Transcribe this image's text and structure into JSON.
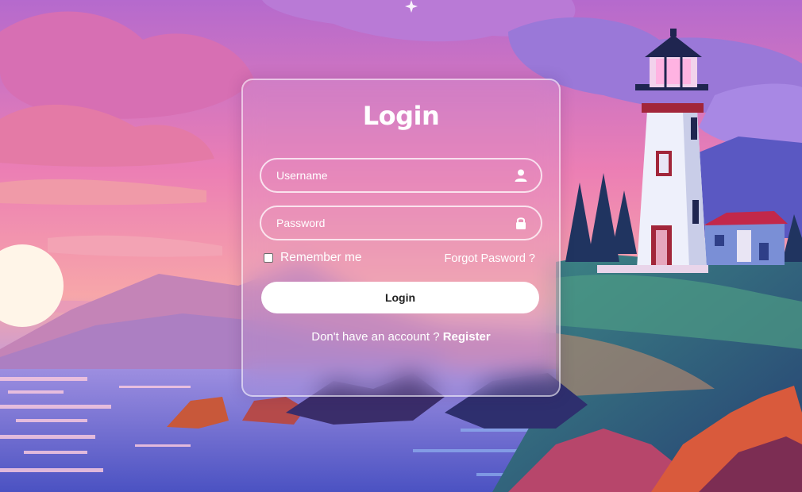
{
  "login_form": {
    "title": "Login",
    "username": {
      "placeholder": "Username",
      "icon": "user-icon"
    },
    "password": {
      "placeholder": "Password",
      "icon": "lock-icon"
    },
    "remember_label": "Remember me",
    "remember_checked": false,
    "forgot_label": "Forgot Pasword ?",
    "submit_label": "Login",
    "register_prompt": "Don't have an account ?",
    "register_link": "Register"
  },
  "colors": {
    "sky_top": "#b86fd0",
    "sky_pink": "#f17fa8",
    "sun": "#fff6e6",
    "water": "#5a5fc7",
    "lighthouse_red": "#a2263a",
    "button_bg": "#ffffff"
  }
}
